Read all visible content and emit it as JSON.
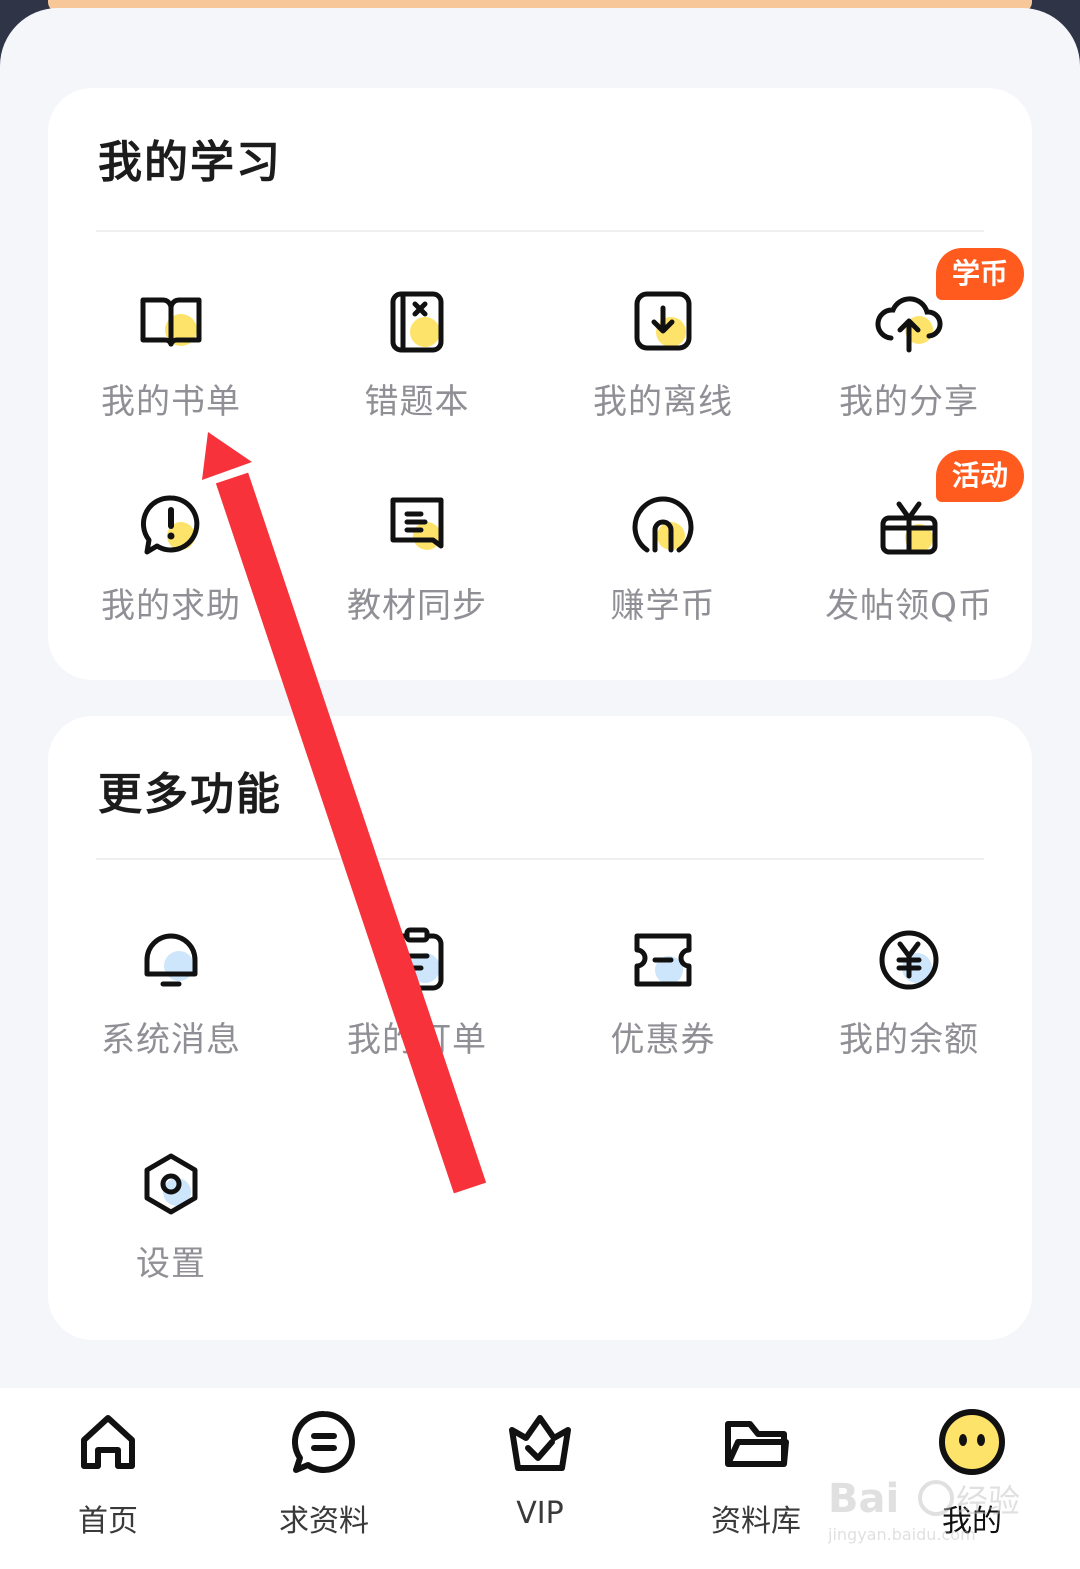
{
  "study": {
    "title": "我的学习",
    "items": [
      {
        "label": "我的书单",
        "icon": "book-list-icon"
      },
      {
        "label": "错题本",
        "icon": "mistake-notebook-icon"
      },
      {
        "label": "我的离线",
        "icon": "offline-download-icon"
      },
      {
        "label": "我的分享",
        "icon": "cloud-upload-icon",
        "badge": "学币"
      },
      {
        "label": "我的求助",
        "icon": "help-exclamation-icon"
      },
      {
        "label": "教材同步",
        "icon": "textbook-sync-icon"
      },
      {
        "label": "赚学币",
        "icon": "earn-coins-icon"
      },
      {
        "label": "发帖领Q币",
        "icon": "gift-icon",
        "badge": "活动"
      }
    ]
  },
  "more": {
    "title": "更多功能",
    "items": [
      {
        "label": "系统消息",
        "icon": "bell-icon"
      },
      {
        "label": "我的订单",
        "icon": "order-clipboard-icon"
      },
      {
        "label": "优惠券",
        "icon": "coupon-ticket-icon"
      },
      {
        "label": "我的余额",
        "icon": "yuan-balance-icon"
      },
      {
        "label": "设置",
        "icon": "settings-gear-icon"
      }
    ]
  },
  "tabbar": {
    "items": [
      {
        "label": "首页",
        "icon": "home-icon"
      },
      {
        "label": "求资料",
        "icon": "chat-request-icon"
      },
      {
        "label": "VIP",
        "icon": "crown-icon"
      },
      {
        "label": "资料库",
        "icon": "folder-icon"
      },
      {
        "label": "我的",
        "icon": "smiley-avatar-icon",
        "active": true
      }
    ]
  },
  "watermark": {
    "text": "Baidu经验",
    "subtext": "jingyan.baidu.com"
  },
  "colors": {
    "accent_yellow": "#fde36a",
    "badge_orange": "#ff5b1e",
    "annotation_red": "#f7323a",
    "label_gray": "#8f8f95"
  }
}
